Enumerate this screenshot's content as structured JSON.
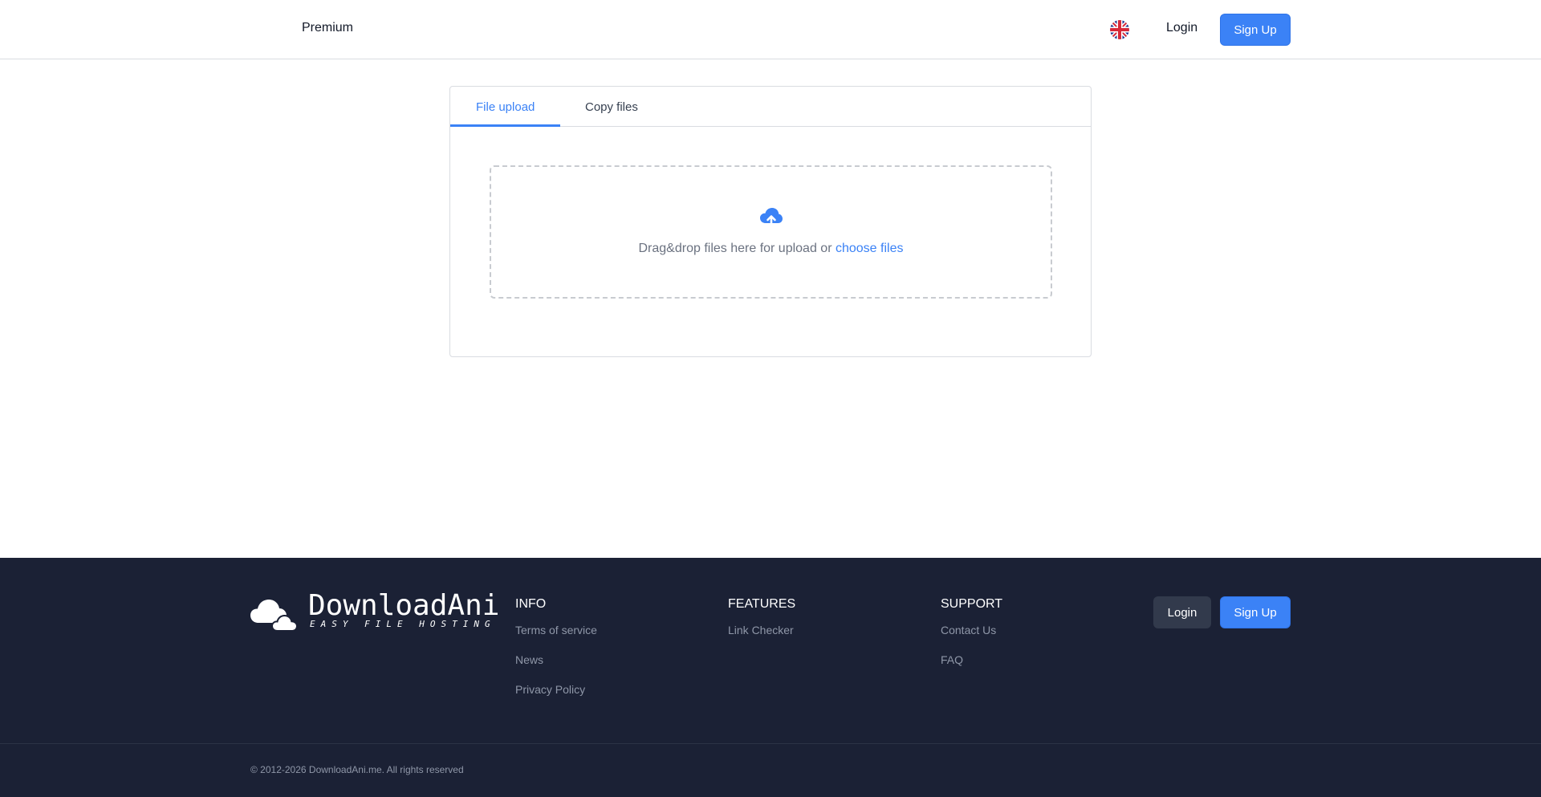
{
  "header": {
    "premium_label": "Premium",
    "language_icon": "uk-flag-icon",
    "login_label": "Login",
    "signup_label": "Sign Up"
  },
  "upload": {
    "tabs": [
      {
        "label": "File upload",
        "active": true
      },
      {
        "label": "Copy files",
        "active": false
      }
    ],
    "icon": "cloud-upload-icon",
    "drop_text": "Drag&drop files here for upload or",
    "choose_link": "choose files"
  },
  "footer": {
    "logo_name": "DownloadAni",
    "logo_tagline": "EASY FILE HOSTING",
    "columns": [
      {
        "title": "INFO",
        "links": [
          "Terms of service",
          "News",
          "Privacy Policy"
        ]
      },
      {
        "title": "FEATURES",
        "links": [
          "Link Checker"
        ]
      },
      {
        "title": "SUPPORT",
        "links": [
          "Contact Us",
          "FAQ"
        ]
      }
    ],
    "login_label": "Login",
    "signup_label": "Sign Up",
    "copyright": "© 2012-2026 DownloadAni.me. All rights reserved"
  },
  "colors": {
    "accent": "#3b82f6",
    "footer_bg": "#1b2135",
    "footer_link": "#8f97a8"
  }
}
